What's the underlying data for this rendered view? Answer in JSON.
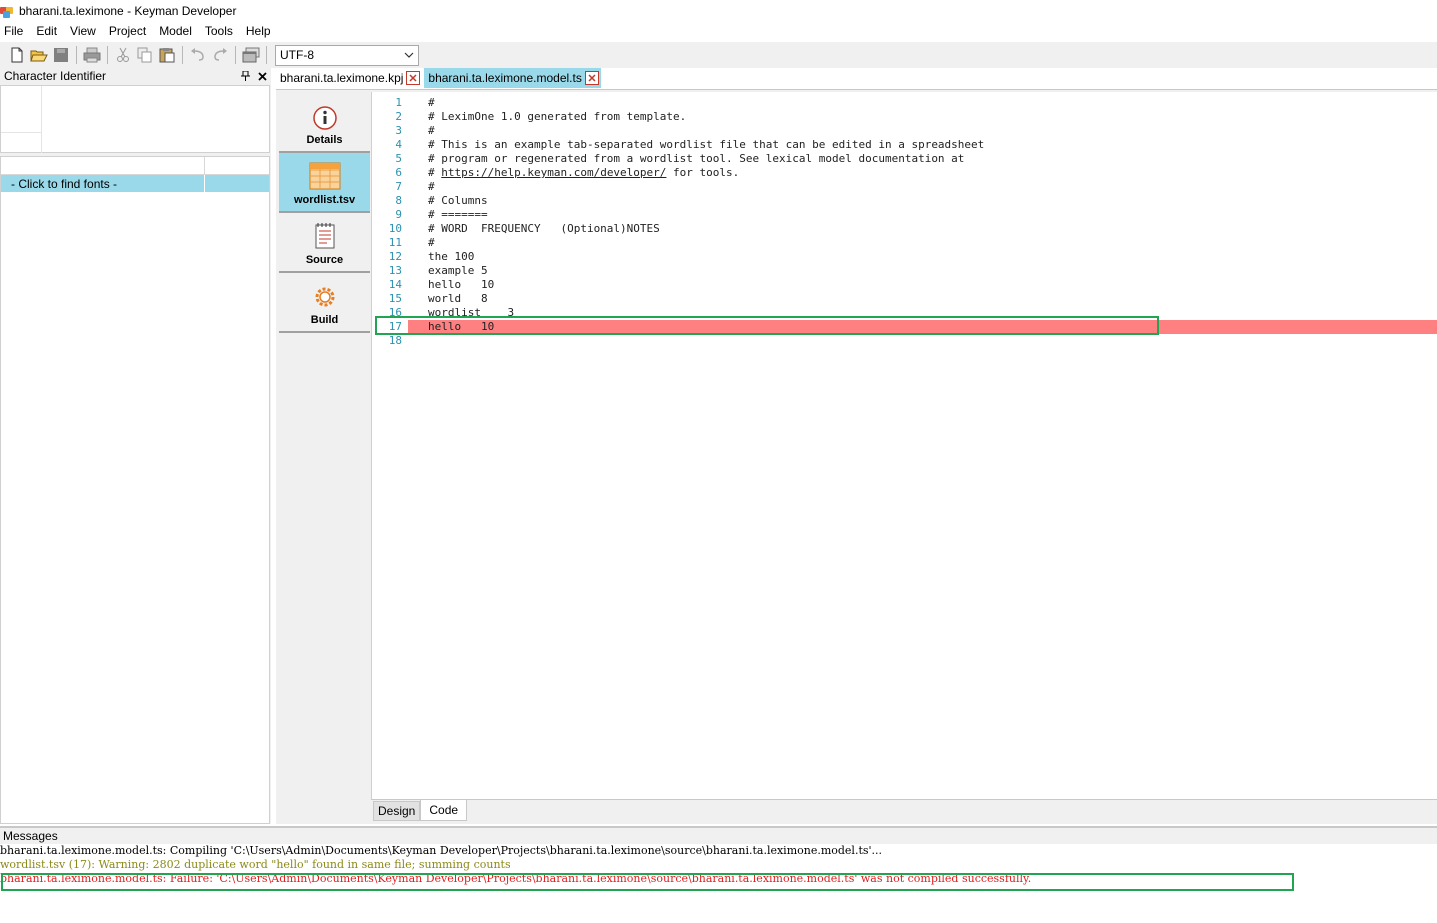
{
  "window": {
    "title": "bharani.ta.leximone - Keyman Developer"
  },
  "menu": [
    "File",
    "Edit",
    "View",
    "Project",
    "Model",
    "Tools",
    "Help"
  ],
  "toolbar": {
    "encoding": "UTF-8",
    "buttons": [
      "new-file-icon",
      "open-folder-icon",
      "save-icon",
      "print-icon",
      "cut-icon",
      "copy-icon",
      "paste-icon",
      "undo-icon",
      "redo-icon",
      "window-icon"
    ]
  },
  "left_panel": {
    "title": "Character Identifier",
    "font_row": "- Click to find fonts -"
  },
  "doc_tabs": [
    {
      "label": "bharani.ta.leximone.kpj",
      "active": false
    },
    {
      "label": "bharani.ta.leximone.model.ts",
      "active": true
    }
  ],
  "side_nav": [
    {
      "label": "Details",
      "icon": "info-icon",
      "active": false
    },
    {
      "label": "wordlist.tsv",
      "icon": "spreadsheet-icon",
      "active": true
    },
    {
      "label": "Source",
      "icon": "document-icon",
      "active": false
    },
    {
      "label": "Build",
      "icon": "gear-icon",
      "active": false
    }
  ],
  "code": {
    "lines": [
      {
        "n": "1",
        "text": "#"
      },
      {
        "n": "2",
        "text": "# LeximOne 1.0 generated from template."
      },
      {
        "n": "3",
        "text": "#"
      },
      {
        "n": "4",
        "text": "# This is an example tab-separated wordlist file that can be edited in a spreadsheet"
      },
      {
        "n": "5",
        "text": "# program or regenerated from a wordlist tool. See lexical model documentation at"
      },
      {
        "n": "6",
        "text": "# ",
        "link": "https://help.keyman.com/developer/",
        "after": " for tools."
      },
      {
        "n": "7",
        "text": "#"
      },
      {
        "n": "8",
        "text": "# Columns"
      },
      {
        "n": "9",
        "text": "# ======="
      },
      {
        "n": "10",
        "text": "# WORD  FREQUENCY   (Optional)NOTES"
      },
      {
        "n": "11",
        "text": "#"
      },
      {
        "n": "12",
        "text": "the 100"
      },
      {
        "n": "13",
        "text": "example 5"
      },
      {
        "n": "14",
        "text": "hello   10"
      },
      {
        "n": "15",
        "text": "world   8"
      },
      {
        "n": "16",
        "text": "wordlist    3"
      },
      {
        "n": "17",
        "text": "hello   10",
        "error": true
      },
      {
        "n": "18",
        "text": ""
      }
    ]
  },
  "view_tabs": [
    {
      "label": "Design",
      "active": false
    },
    {
      "label": "Code",
      "active": true
    }
  ],
  "messages": {
    "title": "Messages",
    "items": [
      {
        "level": "info",
        "text": "bharani.ta.leximone.model.ts: Compiling 'C:\\Users\\Admin\\Documents\\Keyman Developer\\Projects\\bharani.ta.leximone\\source\\bharani.ta.leximone.model.ts'..."
      },
      {
        "level": "warn",
        "text": "wordlist.tsv (17): Warning: 2802 duplicate word \"hello\" found in same file; summing counts"
      },
      {
        "level": "error",
        "text": "bharani.ta.leximone.model.ts: Failure: 'C:\\Users\\Admin\\Documents\\Keyman Developer\\Projects\\bharani.ta.leximone\\source\\bharani.ta.leximone.model.ts' was not compiled successfully."
      }
    ]
  },
  "colors": {
    "accent": "#99d9ea",
    "error_line": "#ff8080",
    "highlight_box": "#22a552",
    "line_number": "#2b91af",
    "warning_text": "#8a8a1a",
    "error_text": "#e02020"
  }
}
